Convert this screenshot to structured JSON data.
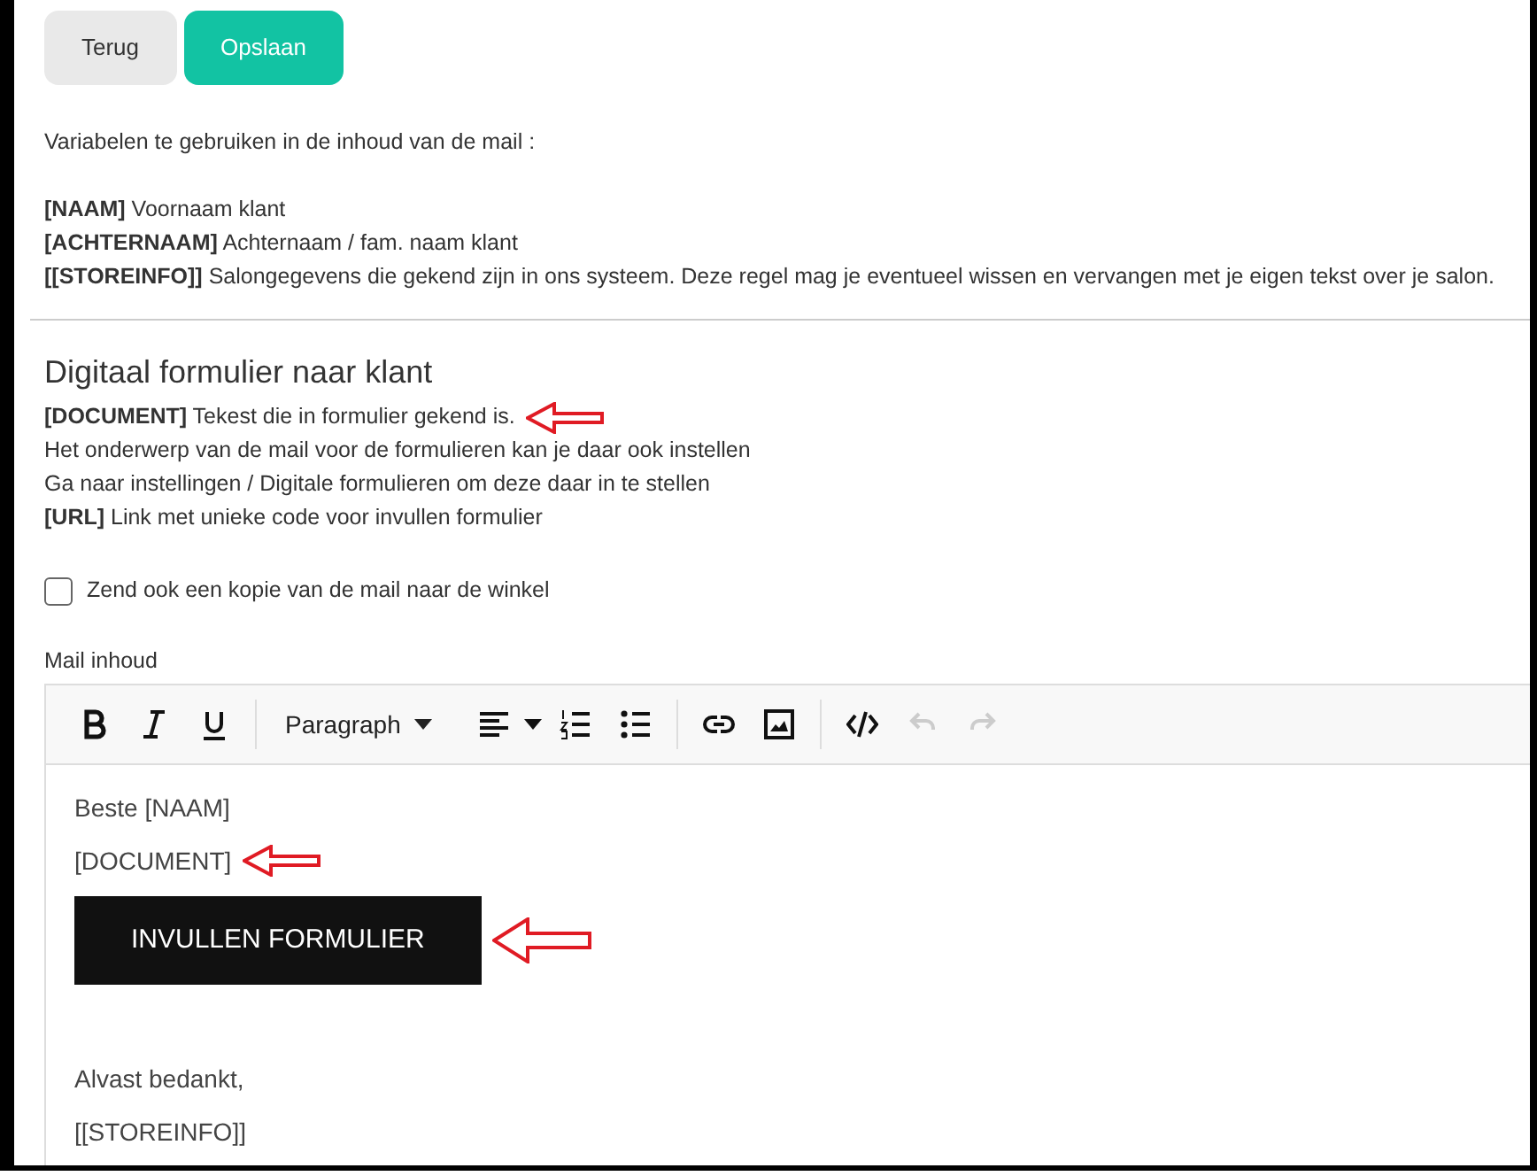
{
  "buttons": [
    {
      "label": "Terug",
      "kind": "secondary"
    },
    {
      "label": "Opslaan",
      "kind": "primary"
    }
  ],
  "variables_intro": "Variabelen te gebruiken in de inhoud van de mail :",
  "variables": [
    "**[NAAM]** Voornaam klant",
    "**[ACHTERNAAM]** Achternaam / fam. naam klant",
    "**[[STOREINFO]]** Salongegevens die gekend zijn in ons systeem. Deze regel mag je eventueel wissen en vervangen met je eigen tekst over je salon."
  ],
  "section_title": "Digitaal formulier naar klant",
  "section_lines": [
    {
      "text": "**[DOCUMENT]** Tekest die in formulier gekend is.",
      "annotated": true
    },
    {
      "text": "Het onderwerp van de mail voor de formulieren kan je daar ook instellen",
      "annotated": false
    },
    {
      "text": "Ga naar instellingen / Digitale formulieren om deze daar in te stellen",
      "annotated": false
    },
    {
      "text": "**[URL]** Link met unieke code voor invullen formulier",
      "annotated": false
    }
  ],
  "copy_checkbox": {
    "label": "Zend ook een kopie van de mail naar de winkel",
    "checked": false
  },
  "editor": {
    "label": "Mail inhoud",
    "toolbar": {
      "block_format": "Paragraph",
      "undo": {
        "disabled": true
      },
      "redo": {
        "disabled": true
      }
    },
    "content": [
      {
        "kind": "text",
        "text": "Beste [NAAM]",
        "annotated": false
      },
      {
        "kind": "text",
        "text": "[DOCUMENT]",
        "annotated": true
      },
      {
        "kind": "button",
        "text": "INVULLEN FORMULIER",
        "annotated": true
      },
      {
        "kind": "text",
        "text": "Alvast bedankt,",
        "annotated": false
      },
      {
        "kind": "text",
        "text": "[[STOREINFO]]",
        "annotated": false
      }
    ]
  }
}
